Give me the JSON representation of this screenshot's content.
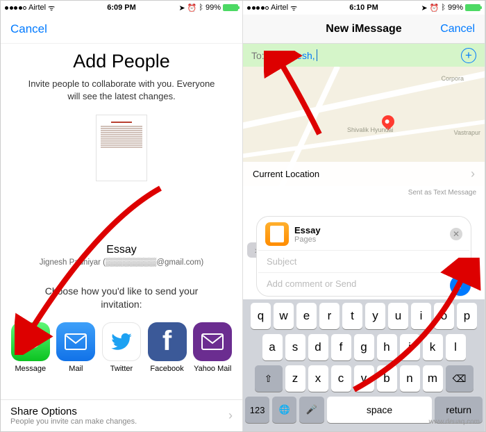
{
  "left": {
    "status": {
      "carrier": "Airtel",
      "time": "6:09 PM",
      "battery": "99%"
    },
    "cancel": "Cancel",
    "title": "Add People",
    "subtitle": "Invite people to collaborate with you. Everyone will see the latest changes.",
    "doc_title": "Essay",
    "doc_owner": "Jignesh Padhiyar (▒▒▒▒▒▒▒▒▒@gmail.com)",
    "choose": "Choose how you'd like to send your invitation:",
    "apps": {
      "message": "Message",
      "mail": "Mail",
      "twitter": "Twitter",
      "facebook": "Facebook",
      "yahoo": "Yahoo Mail"
    },
    "share_options": {
      "title": "Share Options",
      "sub": "People you invite can make changes."
    }
  },
  "right": {
    "status": {
      "carrier": "Airtel",
      "time": "6:10 PM",
      "battery": "99%"
    },
    "nav_title": "New iMessage",
    "cancel": "Cancel",
    "to_label": "To:",
    "to_contact": "Dhvanesh,",
    "map": {
      "poi1": "Shivalik Hyundai",
      "poi2": "Corpora",
      "poi3": "Vastrapur",
      "cur_loc": "Current Location"
    },
    "sent_as": "Sent as Text Message",
    "attachment": {
      "title": "Essay",
      "sub": "Pages"
    },
    "subject_placeholder": "Subject",
    "comment_placeholder": "Add comment or Send",
    "keyboard": {
      "row1": [
        "q",
        "w",
        "e",
        "r",
        "t",
        "y",
        "u",
        "i",
        "o",
        "p"
      ],
      "row2": [
        "a",
        "s",
        "d",
        "f",
        "g",
        "h",
        "j",
        "k",
        "l"
      ],
      "row3": [
        "z",
        "x",
        "c",
        "v",
        "b",
        "n",
        "m"
      ],
      "num": "123",
      "space": "space",
      "return": "return"
    }
  },
  "watermark": "www.deuaq.com"
}
